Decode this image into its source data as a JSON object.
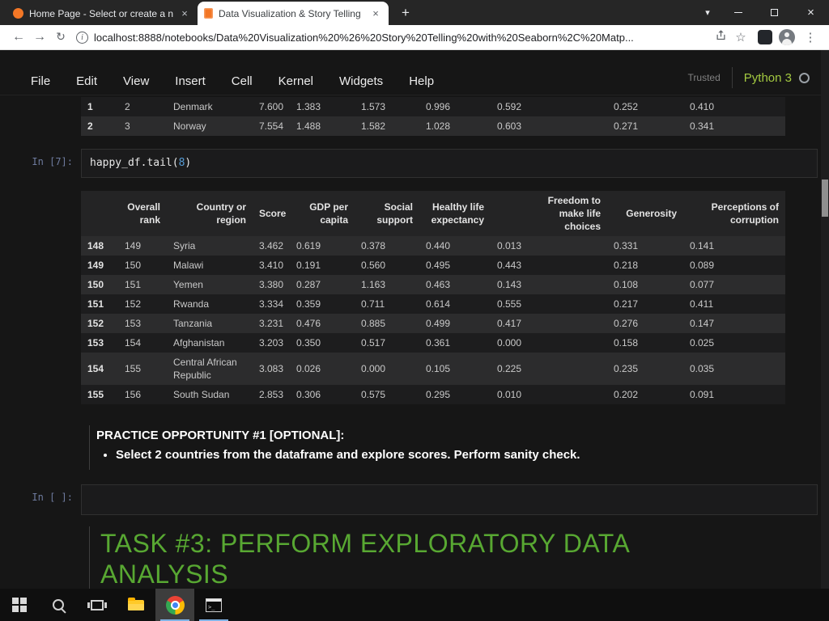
{
  "browser": {
    "tabs": [
      {
        "title": "Home Page - Select or create a n",
        "favicon": "jupyter-logo"
      },
      {
        "title": "Data Visualization & Story Telling",
        "favicon": "notebook-book"
      }
    ],
    "url": "localhost:8888/notebooks/Data%20Visualization%20%26%20Story%20Telling%20with%20Seaborn%2C%20Matp...",
    "toolbar_icons": [
      "back",
      "forward",
      "reload",
      "page-info",
      "share",
      "bookmark-star",
      "extension",
      "profile-avatar",
      "menu-dots"
    ],
    "window_controls": [
      "tab-search-chevron",
      "minimize",
      "maximize",
      "close"
    ]
  },
  "notebook": {
    "menu_items": [
      "File",
      "Edit",
      "View",
      "Insert",
      "Cell",
      "Kernel",
      "Widgets",
      "Help"
    ],
    "trusted_label": "Trusted",
    "kernel_name": "Python 3",
    "kernel_status_icon": "idle-circle"
  },
  "cells": {
    "partial_table": {
      "rows": [
        {
          "index": "1",
          "cells": [
            "2",
            "Denmark",
            "7.600",
            "1.383",
            "1.573",
            "0.996",
            "0.592",
            "0.252",
            "0.410"
          ]
        },
        {
          "index": "2",
          "cells": [
            "3",
            "Norway",
            "7.554",
            "1.488",
            "1.582",
            "1.028",
            "0.603",
            "0.271",
            "0.341"
          ]
        }
      ]
    },
    "code_cell": {
      "prompt": "In [7]:",
      "code_text": "happy_df.tail(",
      "code_arg": "8",
      "code_close": ")"
    },
    "output_table": {
      "headers": [
        "Overall rank",
        "Country or region",
        "Score",
        "GDP per capita",
        "Social support",
        "Healthy life expectancy",
        "Freedom to make life choices",
        "Generosity",
        "Perceptions of corruption"
      ],
      "rows": [
        {
          "index": "148",
          "cells": [
            "149",
            "Syria",
            "3.462",
            "0.619",
            "0.378",
            "0.440",
            "0.013",
            "0.331",
            "0.141"
          ]
        },
        {
          "index": "149",
          "cells": [
            "150",
            "Malawi",
            "3.410",
            "0.191",
            "0.560",
            "0.495",
            "0.443",
            "0.218",
            "0.089"
          ]
        },
        {
          "index": "150",
          "cells": [
            "151",
            "Yemen",
            "3.380",
            "0.287",
            "1.163",
            "0.463",
            "0.143",
            "0.108",
            "0.077"
          ]
        },
        {
          "index": "151",
          "cells": [
            "152",
            "Rwanda",
            "3.334",
            "0.359",
            "0.711",
            "0.614",
            "0.555",
            "0.217",
            "0.411"
          ]
        },
        {
          "index": "152",
          "cells": [
            "153",
            "Tanzania",
            "3.231",
            "0.476",
            "0.885",
            "0.499",
            "0.417",
            "0.276",
            "0.147"
          ]
        },
        {
          "index": "153",
          "cells": [
            "154",
            "Afghanistan",
            "3.203",
            "0.350",
            "0.517",
            "0.361",
            "0.000",
            "0.158",
            "0.025"
          ]
        },
        {
          "index": "154",
          "cells": [
            "155",
            "Central African Republic",
            "3.083",
            "0.026",
            "0.000",
            "0.105",
            "0.225",
            "0.235",
            "0.035"
          ]
        },
        {
          "index": "155",
          "cells": [
            "156",
            "South Sudan",
            "2.853",
            "0.306",
            "0.575",
            "0.295",
            "0.010",
            "0.202",
            "0.091"
          ]
        }
      ]
    },
    "practice_cell": {
      "title": "PRACTICE OPPORTUNITY #1 [OPTIONAL]:",
      "bullet": "Select 2 countries from the dataframe and explore scores. Perform sanity check."
    },
    "empty_cell": {
      "prompt": "In [ ]:"
    },
    "task_heading": "TASK #3: PERFORM EXPLORATORY DATA ANALYSIS"
  },
  "colors": {
    "jupyter_orange": "#f37726",
    "kernel_green": "#a3c940",
    "heading_green": "#58a832",
    "code_number_blue": "#569cd6",
    "taskbar_underline": "#7fb2e5"
  },
  "taskbar": {
    "icons": [
      "start",
      "search",
      "task-view",
      "file-explorer",
      "chrome",
      "terminal"
    ]
  }
}
